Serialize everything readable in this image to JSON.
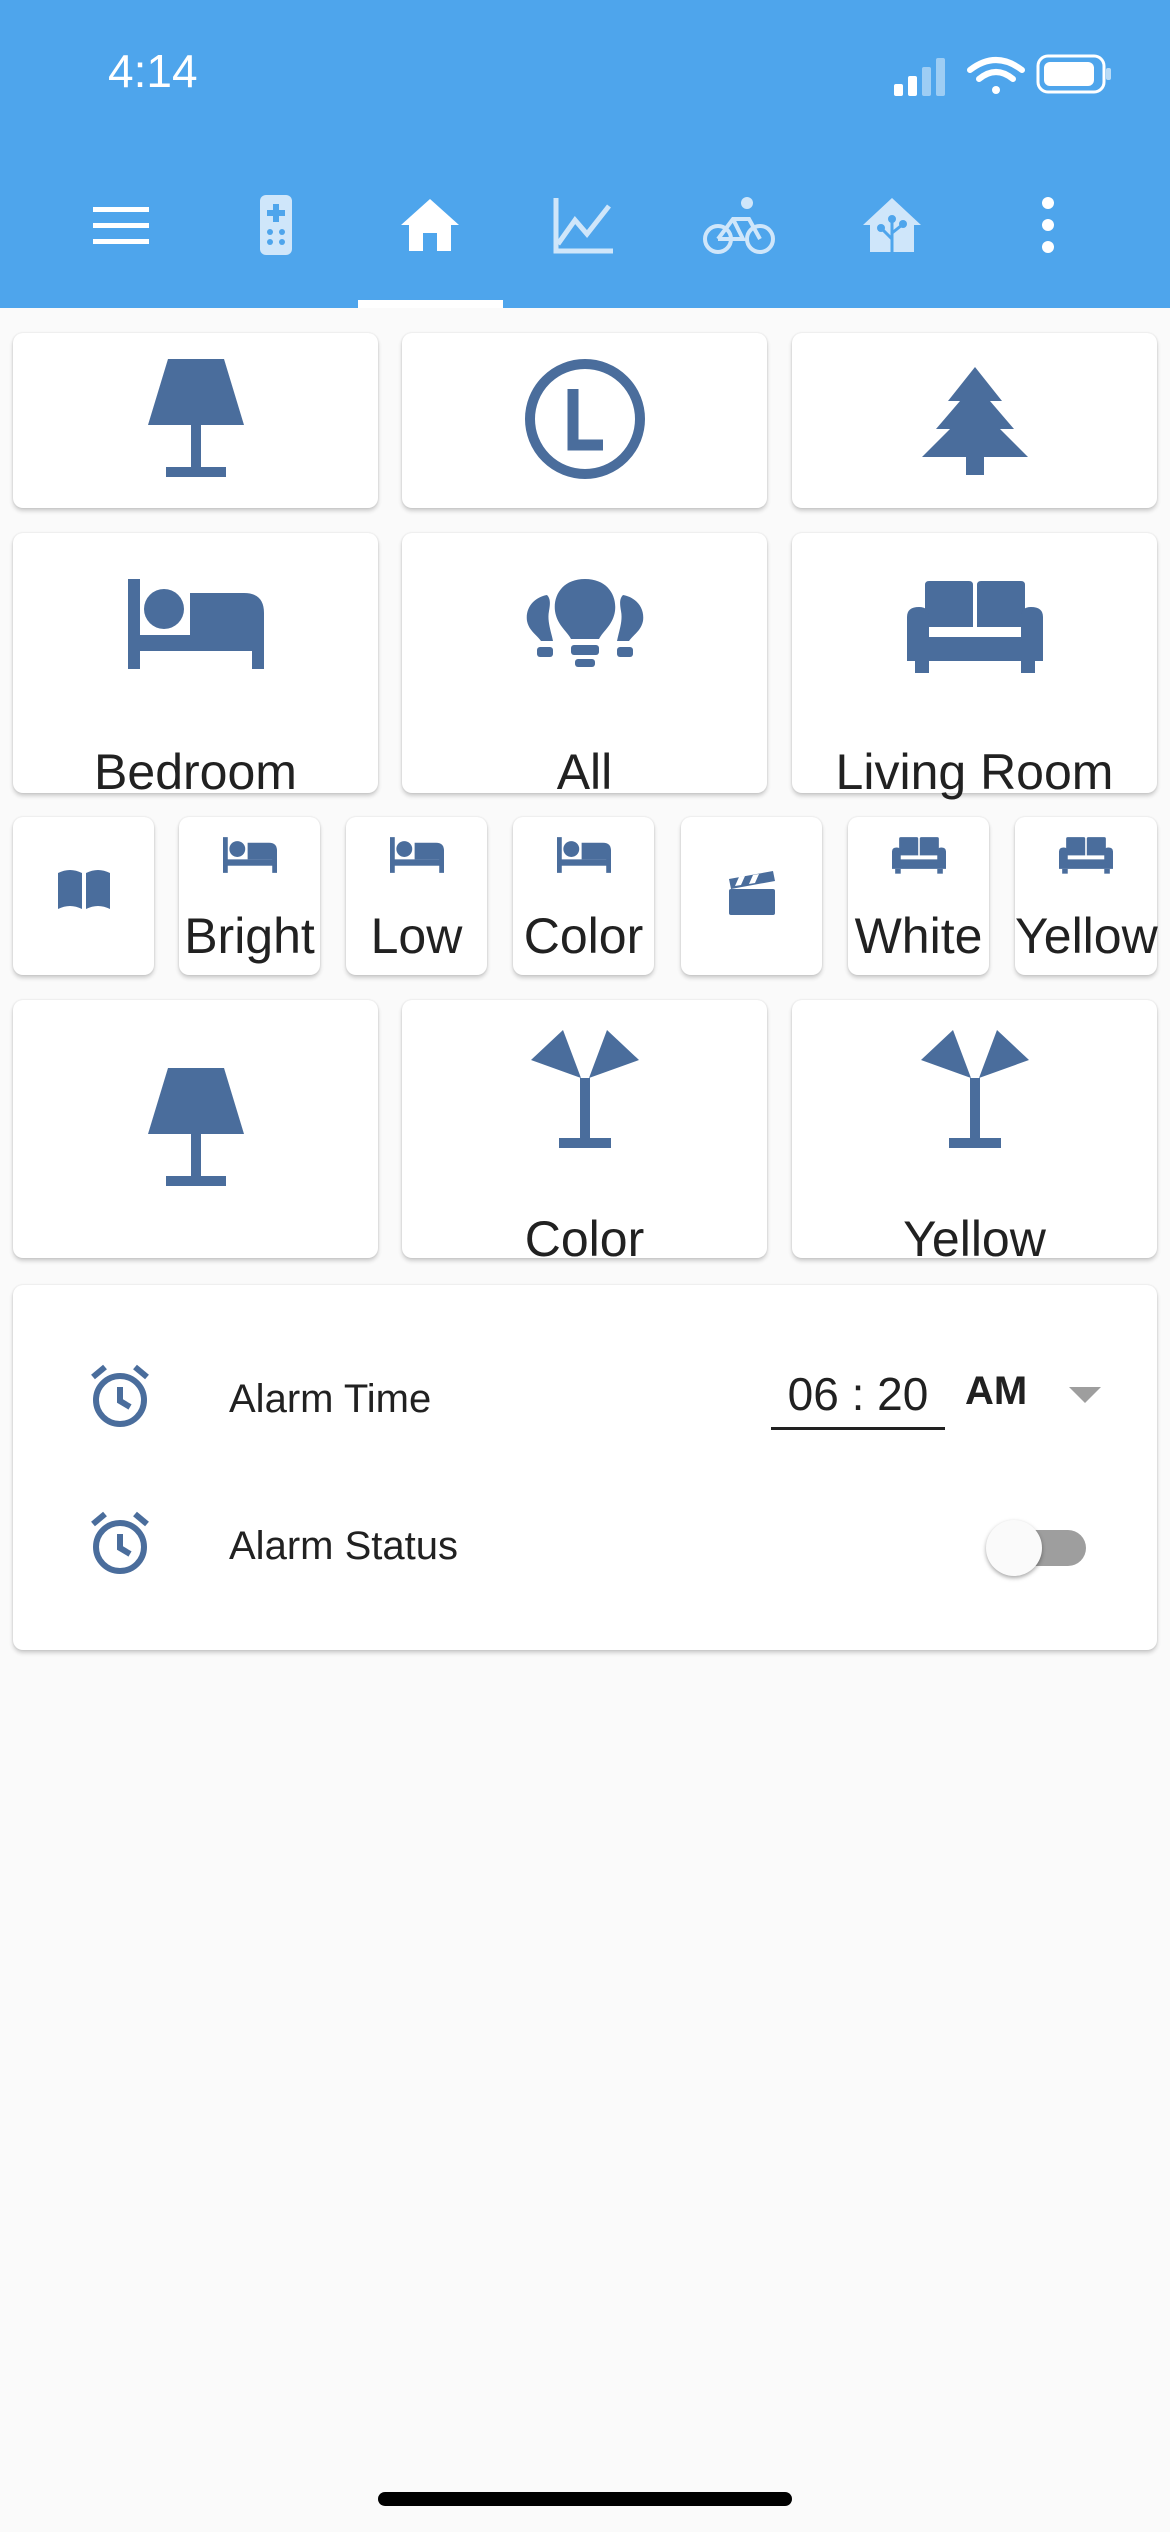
{
  "status_bar": {
    "time": "4:14"
  },
  "tabs": [
    {
      "name": "menu-icon"
    },
    {
      "name": "remote-icon"
    },
    {
      "name": "home-icon",
      "active": true
    },
    {
      "name": "chart-line-icon"
    },
    {
      "name": "bike-icon"
    },
    {
      "name": "home-assistant-icon"
    },
    {
      "name": "more-vertical-icon"
    }
  ],
  "row1": [
    {
      "icon": "lamp-icon",
      "label": ""
    },
    {
      "icon": "clock-letter-l-icon",
      "label": ""
    },
    {
      "icon": "pine-tree-icon",
      "label": ""
    }
  ],
  "row2": [
    {
      "icon": "bed-icon",
      "label": "Bedroom"
    },
    {
      "icon": "bulbs-group-icon",
      "label": "All"
    },
    {
      "icon": "sofa-icon",
      "label": "Living Room"
    }
  ],
  "row3": [
    {
      "icon": "book-open-icon",
      "label": ""
    },
    {
      "icon": "bed-icon",
      "label": "Bright"
    },
    {
      "icon": "bed-icon",
      "label": "Low"
    },
    {
      "icon": "bed-icon",
      "label": "Color"
    },
    {
      "icon": "movie-clapper-icon",
      "label": ""
    },
    {
      "icon": "sofa-icon",
      "label": "White"
    },
    {
      "icon": "sofa-icon",
      "label": "Yellow"
    }
  ],
  "row4": [
    {
      "icon": "lamp-icon",
      "label": ""
    },
    {
      "icon": "floor-lamp-dual-icon",
      "label": "Color"
    },
    {
      "icon": "floor-lamp-dual-icon",
      "label": "Yellow"
    }
  ],
  "entities": {
    "alarm_time": {
      "label": "Alarm Time",
      "value": "06 : 20",
      "ampm": "AM"
    },
    "alarm_status": {
      "label": "Alarm Status",
      "on": false
    }
  },
  "colors": {
    "header": "#4ea5ec",
    "icon": "#4a6d9c",
    "background": "#fafafa"
  }
}
